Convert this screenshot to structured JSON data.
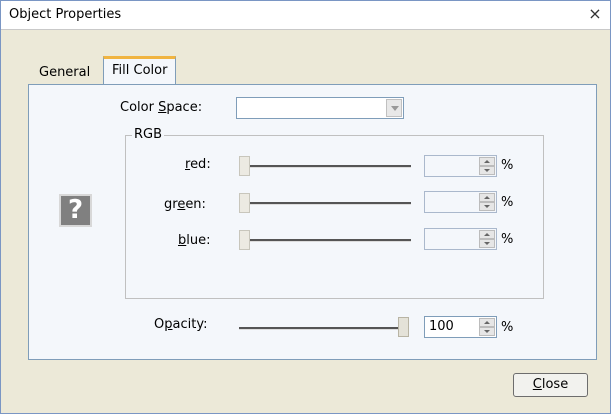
{
  "window": {
    "title": "Object Properties",
    "close_glyph": "×"
  },
  "tabs": [
    {
      "label": "General",
      "active": false
    },
    {
      "label": "Fill Color",
      "active": true
    }
  ],
  "fill_color": {
    "color_space": {
      "label_pre": "Color ",
      "label_ul": "S",
      "label_post": "pace:",
      "value": ""
    },
    "group": {
      "legend": "RGB",
      "channels": [
        {
          "key": "red",
          "label_pre": "",
          "label_ul": "r",
          "label_post": "ed:",
          "value": "",
          "unit": "%"
        },
        {
          "key": "green",
          "label_pre": "gr",
          "label_ul": "e",
          "label_post": "en:",
          "value": "",
          "unit": "%"
        },
        {
          "key": "blue",
          "label_pre": "",
          "label_ul": "b",
          "label_post": "lue:",
          "value": "",
          "unit": "%"
        }
      ]
    },
    "preview_icon": "question-mark-icon",
    "preview_glyph": "?",
    "opacity": {
      "label_pre": "O",
      "label_ul": "p",
      "label_post": "acity:",
      "value": "100",
      "unit": "%",
      "level": 1.0
    }
  },
  "buttons": {
    "close": {
      "label_ul": "C",
      "label_post": "lose"
    }
  },
  "colors": {
    "window_border": "#7a96c4",
    "panel_bg": "#f4f7fb",
    "active_tab_accent": "#f0b441",
    "preview_bg": "#808080"
  }
}
